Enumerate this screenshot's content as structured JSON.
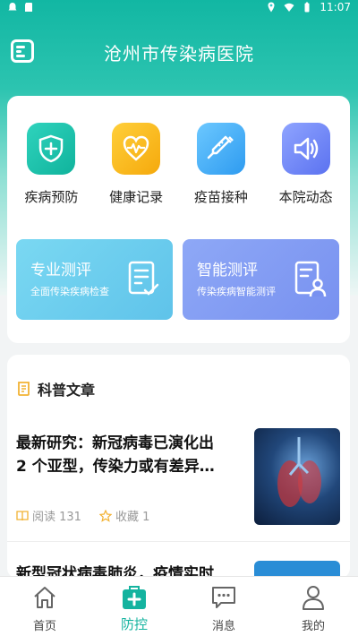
{
  "status_bar": {
    "time": "11:07"
  },
  "header": {
    "title": "沧州市传染病医院"
  },
  "quick_actions": [
    {
      "label": "疾病预防",
      "icon": "shield-plus-icon"
    },
    {
      "label": "健康记录",
      "icon": "heart-pulse-icon"
    },
    {
      "label": "疫苗接种",
      "icon": "syringe-icon"
    },
    {
      "label": "本院动态",
      "icon": "speaker-icon"
    }
  ],
  "evaluations": [
    {
      "title": "专业测评",
      "subtitle": "全面传染疾病检查",
      "icon": "checklist-icon"
    },
    {
      "title": "智能测评",
      "subtitle": "传染疾病智能测评",
      "icon": "person-report-icon"
    }
  ],
  "articles_section": {
    "title": "科普文章",
    "articles": [
      {
        "title": "最新研究：新冠病毒已演化出 2 个亚型，传染力或有差异…",
        "reads_label": "阅读 131",
        "favorites_label": "收藏 1"
      },
      {
        "title": "新型冠状病毒肺炎，疫情实时"
      }
    ]
  },
  "tabbar": [
    {
      "label": "首页",
      "icon": "home-icon"
    },
    {
      "label": "防控",
      "icon": "medical-kit-icon",
      "active": true
    },
    {
      "label": "消息",
      "icon": "message-icon"
    },
    {
      "label": "我的",
      "icon": "user-icon"
    }
  ],
  "colors": {
    "accent": "#14b39f"
  }
}
